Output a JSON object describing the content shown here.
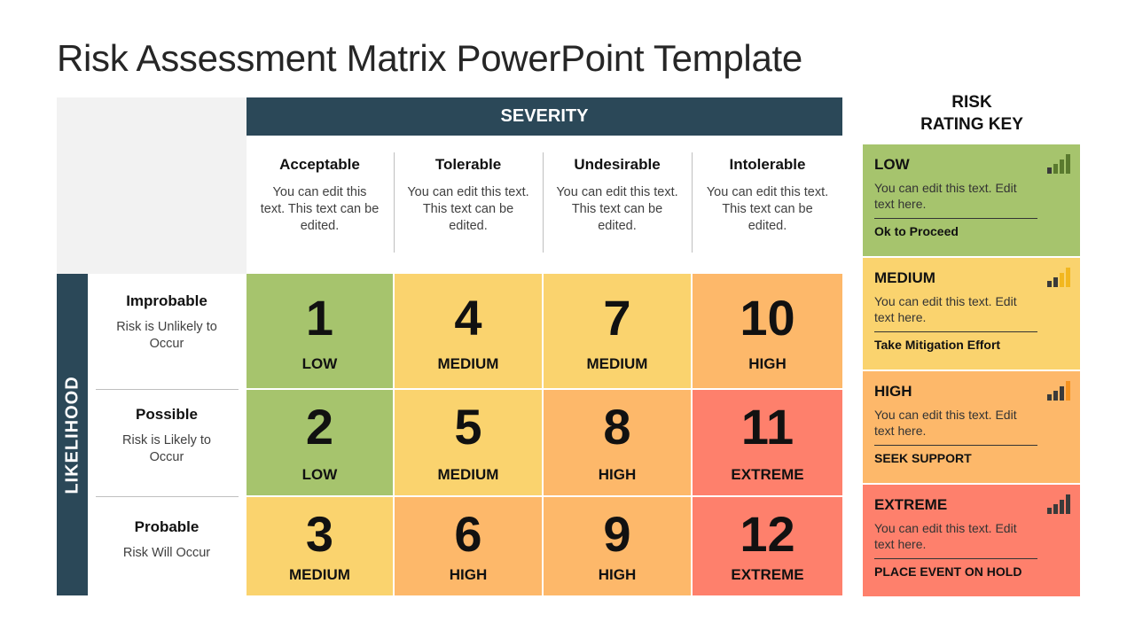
{
  "title": "Risk Assessment Matrix PowerPoint Template",
  "severity": {
    "label": "SEVERITY",
    "columns": [
      {
        "heading": "Acceptable",
        "desc": "You can edit this text. This text can be edited."
      },
      {
        "heading": "Tolerable",
        "desc": "You can edit this text. This text can be edited."
      },
      {
        "heading": "Undesirable",
        "desc": "You can edit this text. This text can be edited."
      },
      {
        "heading": "Intolerable",
        "desc": "You can edit this text. This text can be edited."
      }
    ]
  },
  "likelihood": {
    "label": "LIKELIHOOD",
    "rows": [
      {
        "heading": "Improbable",
        "desc": "Risk is Unlikely to Occur"
      },
      {
        "heading": "Possible",
        "desc": "Risk is Likely to Occur"
      },
      {
        "heading": "Probable",
        "desc": "Risk Will Occur"
      }
    ]
  },
  "colors": {
    "low": "#a6c46d",
    "medium": "#fad36e",
    "high": "#fdb86a",
    "extreme": "#fe806c",
    "header": "#2b4858"
  },
  "matrix": [
    [
      {
        "num": "1",
        "level": "LOW",
        "key": "low"
      },
      {
        "num": "4",
        "level": "MEDIUM",
        "key": "medium"
      },
      {
        "num": "7",
        "level": "MEDIUM",
        "key": "medium"
      },
      {
        "num": "10",
        "level": "HIGH",
        "key": "high"
      }
    ],
    [
      {
        "num": "2",
        "level": "LOW",
        "key": "low"
      },
      {
        "num": "5",
        "level": "MEDIUM",
        "key": "medium"
      },
      {
        "num": "8",
        "level": "HIGH",
        "key": "high"
      },
      {
        "num": "11",
        "level": "EXTREME",
        "key": "extreme"
      }
    ],
    [
      {
        "num": "3",
        "level": "MEDIUM",
        "key": "medium"
      },
      {
        "num": "6",
        "level": "HIGH",
        "key": "high"
      },
      {
        "num": "9",
        "level": "HIGH",
        "key": "high"
      },
      {
        "num": "12",
        "level": "EXTREME",
        "key": "extreme"
      }
    ]
  ],
  "rating_key": {
    "title_line1": "RISK",
    "title_line2": "RATING KEY",
    "items": [
      {
        "level": "LOW",
        "desc": "You can edit this text. Edit text here.",
        "action": "Ok to Proceed",
        "key": "low",
        "signal_bars": 1,
        "icon": "signal-strength-icon",
        "bar_light": "#5a7a2e"
      },
      {
        "level": "MEDIUM",
        "desc": "You can edit this text. Edit text here.",
        "action": "Take Mitigation Effort",
        "key": "medium",
        "signal_bars": 2,
        "icon": "signal-strength-icon",
        "bar_light": "#f2b71f"
      },
      {
        "level": "HIGH",
        "desc": "You can edit this text. Edit text here.",
        "action": "SEEK SUPPORT",
        "key": "high",
        "signal_bars": 3,
        "icon": "signal-strength-icon",
        "bar_light": "#f5921e"
      },
      {
        "level": "EXTREME",
        "desc": "You can edit this text. Edit text here.",
        "action": "PLACE EVENT ON HOLD",
        "key": "extreme",
        "signal_bars": 4,
        "icon": "signal-strength-icon",
        "bar_light": "#4a3030"
      }
    ]
  }
}
